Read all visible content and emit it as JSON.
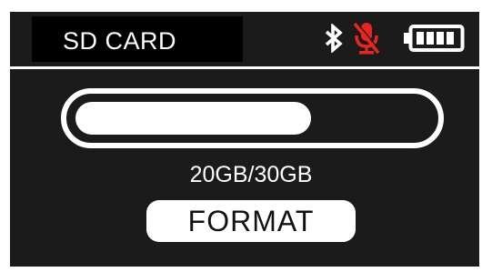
{
  "header": {
    "title": "SD CARD",
    "status_icons": {
      "bluetooth": "bluetooth-icon",
      "microphone": "mic-muted-icon",
      "battery": "battery-icon"
    },
    "battery_level": 1.0,
    "mic_color": "#e8261f"
  },
  "storage": {
    "used_fraction": 0.667,
    "capacity_label": "20GB/30GB"
  },
  "actions": {
    "format_label": "FORMAT"
  },
  "colors": {
    "background": "#1b1b1b",
    "foreground": "#ffffff",
    "accent_red": "#e8261f"
  }
}
